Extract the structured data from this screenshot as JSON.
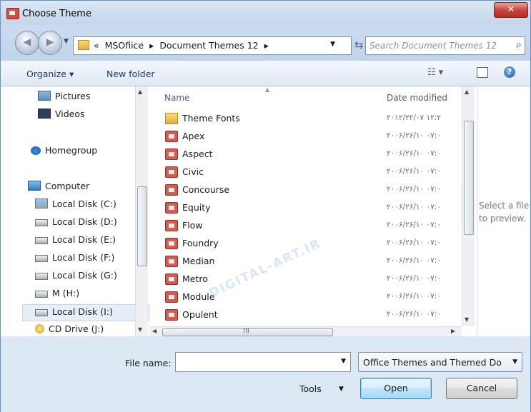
{
  "window": {
    "title": "Choose Theme",
    "close_glyph": "✕"
  },
  "address": {
    "chevron": "«",
    "crumbs": [
      "MSOfiice",
      "▸",
      "Document Themes 12",
      "▸"
    ],
    "search_placeholder": "Search Document Themes 12"
  },
  "toolbar": {
    "organize": "Organize ▾",
    "new_folder": "New folder",
    "views_icon": "☷ ▾",
    "help_glyph": "?"
  },
  "nav": {
    "items": [
      {
        "label": "Pictures",
        "icon": "pictures-icon"
      },
      {
        "label": "Videos",
        "icon": "videos-icon"
      },
      {
        "label": "Homegroup",
        "icon": "homegroup-icon"
      },
      {
        "label": "Computer",
        "icon": "computer-icon"
      },
      {
        "label": "Local Disk (C:)",
        "icon": "system-disk-icon"
      },
      {
        "label": "Local Disk (D:)",
        "icon": "disk-icon"
      },
      {
        "label": "Local Disk (E:)",
        "icon": "disk-icon"
      },
      {
        "label": "Local Disk (F:)",
        "icon": "disk-icon"
      },
      {
        "label": "Local Disk (G:)",
        "icon": "disk-icon"
      },
      {
        "label": "M (H:)",
        "icon": "disk-icon"
      },
      {
        "label": "Local Disk (I:)",
        "icon": "disk-icon",
        "selected": true
      },
      {
        "label": "CD Drive (J:)",
        "icon": "cd-drive-icon"
      }
    ]
  },
  "files": {
    "columns": {
      "name": "Name",
      "date": "Date modified"
    },
    "rows": [
      {
        "name": "Theme Fonts",
        "date": "۲۰۱۲/۲۲/۰۷ ۱۲:۲",
        "icon": "folder-icon"
      },
      {
        "name": "Apex",
        "date": "۲۰۰۶/۲۶/۱۰ ۰۷:۰",
        "icon": "theme-file-icon"
      },
      {
        "name": "Aspect",
        "date": "۲۰۰۶/۲۶/۱۰ ۰۷:۰",
        "icon": "theme-file-icon"
      },
      {
        "name": "Civic",
        "date": "۲۰۰۶/۲۶/۱۰ ۰۷:۰",
        "icon": "theme-file-icon"
      },
      {
        "name": "Concourse",
        "date": "۲۰۰۶/۲۶/۱۰ ۰۷:۰",
        "icon": "theme-file-icon"
      },
      {
        "name": "Equity",
        "date": "۲۰۰۶/۲۶/۱۰ ۰۷:۰",
        "icon": "theme-file-icon"
      },
      {
        "name": "Flow",
        "date": "۲۰۰۶/۲۶/۱۰ ۰۷:۰",
        "icon": "theme-file-icon"
      },
      {
        "name": "Foundry",
        "date": "۲۰۰۶/۲۶/۱۰ ۰۷:۰",
        "icon": "theme-file-icon"
      },
      {
        "name": "Median",
        "date": "۲۰۰۶/۲۶/۱۰ ۰۷:۰",
        "icon": "theme-file-icon"
      },
      {
        "name": "Metro",
        "date": "۲۰۰۶/۲۶/۱۰ ۰۷:۰",
        "icon": "theme-file-icon"
      },
      {
        "name": "Module",
        "date": "۲۰۰۶/۲۶/۱۰ ۰۷:۰",
        "icon": "theme-file-icon"
      },
      {
        "name": "Opulent",
        "date": "۲۰۰۶/۲۶/۱۰ ۰۷:۰",
        "icon": "theme-file-icon"
      }
    ],
    "hscroll_grip": "III"
  },
  "preview": {
    "text": "Select a file\nto preview."
  },
  "watermark": "DIGITAL-ART.IR",
  "footer": {
    "file_name_label": "File name:",
    "file_name_value": "",
    "file_type": "Office Themes and Themed Do",
    "tools": "Tools",
    "open": "Open",
    "cancel": "Cancel"
  },
  "colors": {
    "accent": "#3c7fb1",
    "frame": "#c9dbee",
    "selected_row": "#e6eef8"
  }
}
